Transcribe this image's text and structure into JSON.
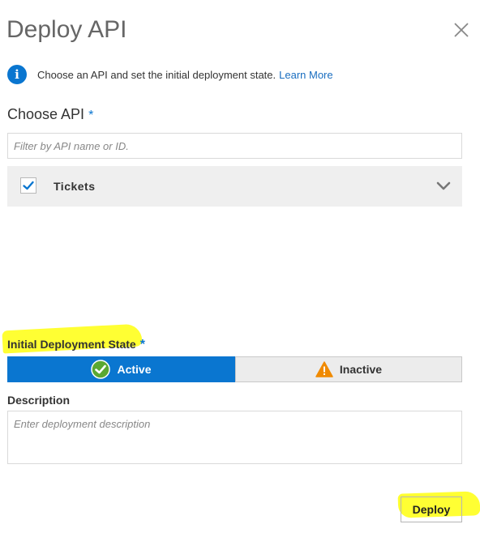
{
  "dialog": {
    "title": "Deploy API",
    "close_icon": "close-icon"
  },
  "info": {
    "icon": "info-icon",
    "text": "Choose an API and set the initial deployment state.",
    "link": "Learn More"
  },
  "choose_api": {
    "label": "Choose API",
    "required_mark": "*",
    "filter_placeholder": "Filter by API name or ID.",
    "items": [
      {
        "label": "Tickets",
        "checked": true
      }
    ]
  },
  "deployment_state": {
    "label": "Initial Deployment State",
    "required_mark": "*",
    "options": [
      {
        "label": "Active",
        "selected": true,
        "icon": "check-circle-icon"
      },
      {
        "label": "Inactive",
        "selected": false,
        "icon": "warning-icon"
      }
    ]
  },
  "description": {
    "label": "Description",
    "placeholder": "Enter deployment description"
  },
  "footer": {
    "deploy_label": "Deploy"
  },
  "colors": {
    "accent": "#0a76d0",
    "highlight": "#ffff33",
    "success": "#5aa832",
    "warning": "#f08a00"
  }
}
